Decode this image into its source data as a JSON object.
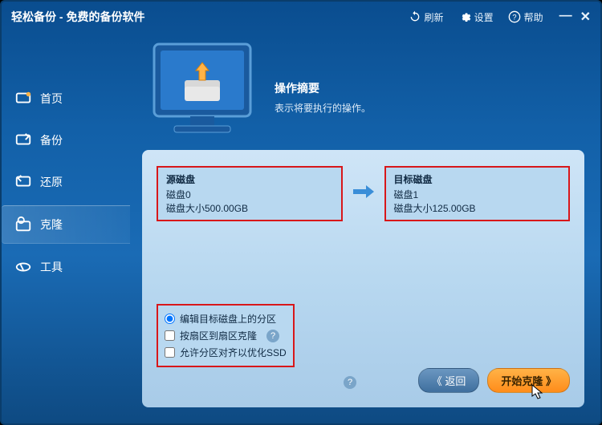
{
  "app_title": "轻松备份 - 免费的备份软件",
  "top": {
    "refresh": "刷新",
    "settings": "设置",
    "help": "帮助"
  },
  "sidebar": {
    "home": "首页",
    "backup": "备份",
    "restore": "还原",
    "clone": "克隆",
    "tools": "工具"
  },
  "summary": {
    "title": "操作摘要",
    "desc": "表示将要执行的操作。"
  },
  "source": {
    "title": "源磁盘",
    "name": "磁盘0",
    "size": "磁盘大小500.00GB"
  },
  "target": {
    "title": "目标磁盘",
    "name": "磁盘1",
    "size": "磁盘大小125.00GB"
  },
  "options": {
    "edit_partitions": "编辑目标磁盘上的分区",
    "sector_clone": "按扇区到扇区克隆",
    "ssd_align": "允许分区对齐以优化SSD"
  },
  "buttons": {
    "back": "《 返回",
    "start": "开始克隆  》"
  }
}
